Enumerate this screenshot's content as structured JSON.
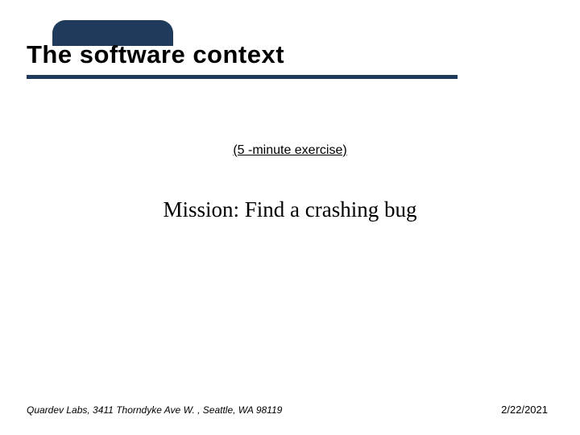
{
  "title": "The software context",
  "subtitle": "(5 -minute exercise)",
  "mission": "Mission: Find a crashing bug",
  "footer": {
    "left": "Quardev Labs, 3411 Thorndyke Ave W. , Seattle, WA  98119",
    "right": "2/22/2021"
  }
}
